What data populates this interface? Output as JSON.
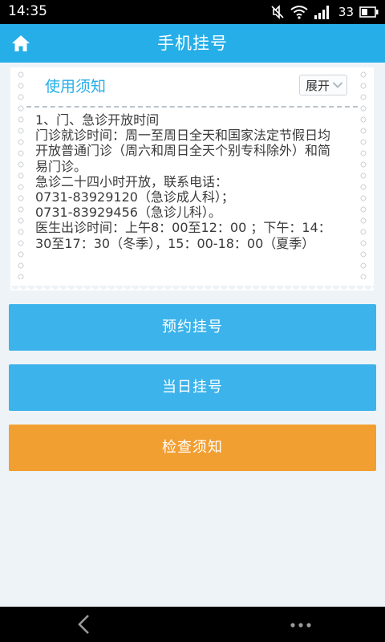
{
  "status_bar": {
    "time": "14:35",
    "battery": "33",
    "icons": [
      "mute-icon",
      "wifi-icon",
      "signal-icon",
      "battery-icon"
    ]
  },
  "header": {
    "title": "手机挂号",
    "home_icon": "home-icon"
  },
  "notice": {
    "title": "使用须知",
    "expand_label": "展开",
    "lines": [
      "1、门、急诊开放时间",
      "门诊就诊时间：周一至周日全天和国家法定节假日均",
      "开放普通门诊（周六和周日全天个别专科除外）和简",
      "易门诊。",
      "急诊二十四小时开放，联系电话：",
      "0731-83929120（急诊成人科）；",
      "0731-83929456（急诊儿科）。",
      "医生出诊时间：上午8：00至12：00 ；下午：14：",
      "30至17：30（冬季），15：00-18：00（夏季）"
    ]
  },
  "actions": {
    "appointment": "预约挂号",
    "same_day": "当日挂号",
    "exam_notice": "检查须知"
  },
  "colors": {
    "primary": "#26aee8",
    "button_blue": "#3cb3ea",
    "button_orange": "#f29f32",
    "background": "#eef3f7"
  },
  "nav_bar": {
    "back_icon": "back-arrow-icon",
    "menu_icon": "more-dots-icon"
  }
}
